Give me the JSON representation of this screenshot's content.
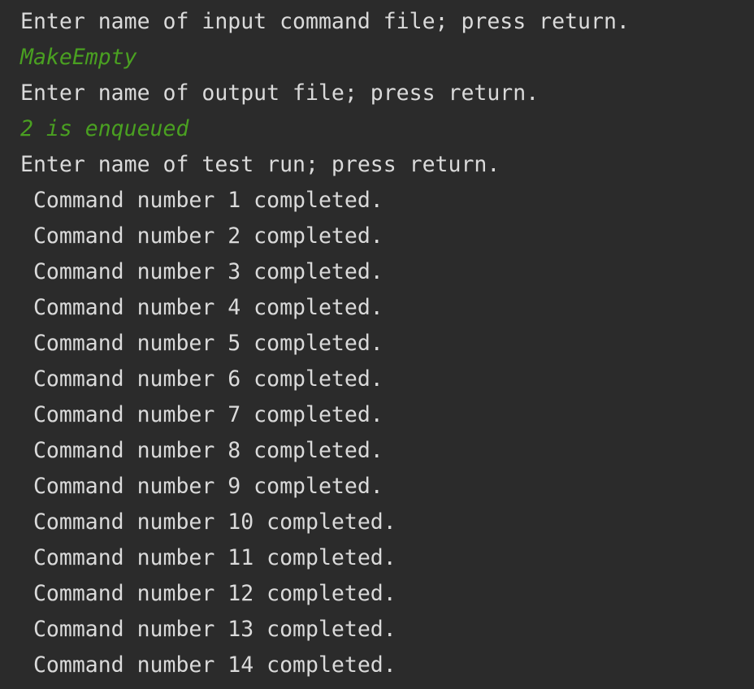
{
  "console": {
    "lines": [
      {
        "text": "Enter name of input command file; press return.",
        "kind": "output"
      },
      {
        "text": "MakeEmpty",
        "kind": "input"
      },
      {
        "text": "Enter name of output file; press return.",
        "kind": "output"
      },
      {
        "text": "2 is enqueued",
        "kind": "input"
      },
      {
        "text": "Enter name of test run; press return.",
        "kind": "output"
      },
      {
        "text": " Command number 1 completed.",
        "kind": "output"
      },
      {
        "text": " Command number 2 completed.",
        "kind": "output"
      },
      {
        "text": " Command number 3 completed.",
        "kind": "output"
      },
      {
        "text": " Command number 4 completed.",
        "kind": "output"
      },
      {
        "text": " Command number 5 completed.",
        "kind": "output"
      },
      {
        "text": " Command number 6 completed.",
        "kind": "output"
      },
      {
        "text": " Command number 7 completed.",
        "kind": "output"
      },
      {
        "text": " Command number 8 completed.",
        "kind": "output"
      },
      {
        "text": " Command number 9 completed.",
        "kind": "output"
      },
      {
        "text": " Command number 10 completed.",
        "kind": "output"
      },
      {
        "text": " Command number 11 completed.",
        "kind": "output"
      },
      {
        "text": " Command number 12 completed.",
        "kind": "output"
      },
      {
        "text": " Command number 13 completed.",
        "kind": "output"
      },
      {
        "text": " Command number 14 completed.",
        "kind": "output"
      }
    ]
  },
  "colors": {
    "background": "#2b2b2b",
    "output_text": "#dadada",
    "user_input_text": "#4aa021"
  }
}
